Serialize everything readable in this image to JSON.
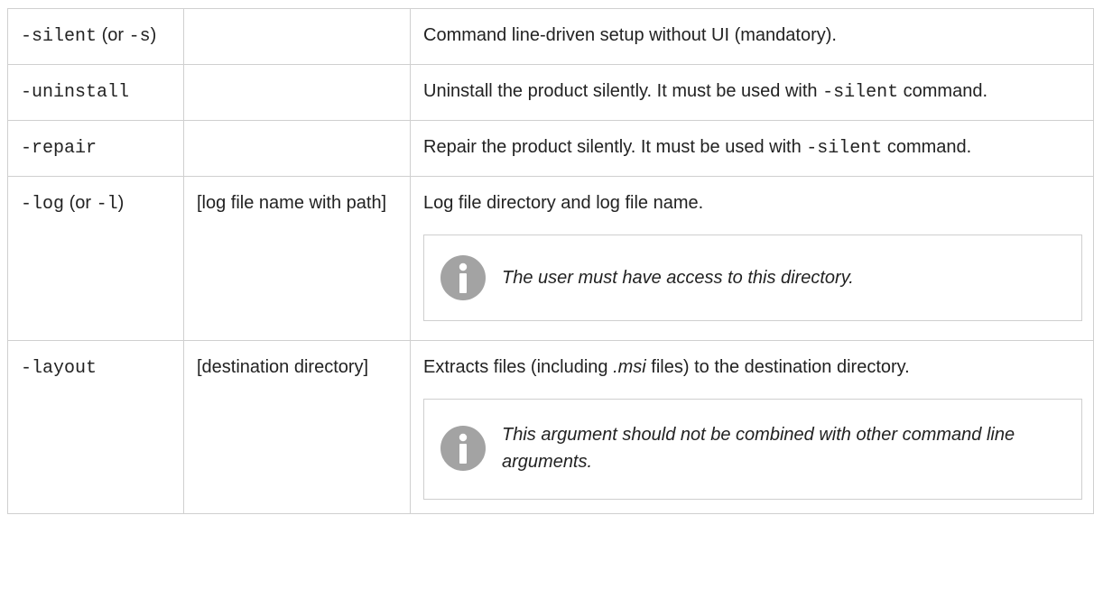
{
  "rows": [
    {
      "arg": "-silent",
      "arg_suffix_1": " (or ",
      "arg_alt": "-s",
      "arg_suffix_2": ")",
      "value": "",
      "desc": "Command line-driven setup without UI (mandatory)."
    },
    {
      "arg": "-uninstall",
      "value": "",
      "desc_pre": "Uninstall the product silently. It must be used with ",
      "desc_code": "-silent",
      "desc_post": " command."
    },
    {
      "arg": "-repair",
      "value": "",
      "desc_pre": "Repair the product silently. It must be used with ",
      "desc_code": "-silent",
      "desc_post": " command."
    },
    {
      "arg": "-log",
      "arg_suffix_1": " (or ",
      "arg_alt": "-l",
      "arg_suffix_2": ")",
      "value": "[log file name with path]",
      "desc": "Log file directory and log file name.",
      "note": "The user must have access to this directory."
    },
    {
      "arg": "-layout",
      "value": "[destination directory]",
      "desc_pre": "Extracts files (including ",
      "desc_em": ".msi",
      "desc_post": " files) to the destination directory.",
      "note": "This argument should not be combined with other command line arguments."
    }
  ],
  "icons": {
    "note": "info-icon"
  },
  "colors": {
    "icon": "#a3a3a3",
    "border": "#d0d0d0",
    "text": "#222222"
  }
}
